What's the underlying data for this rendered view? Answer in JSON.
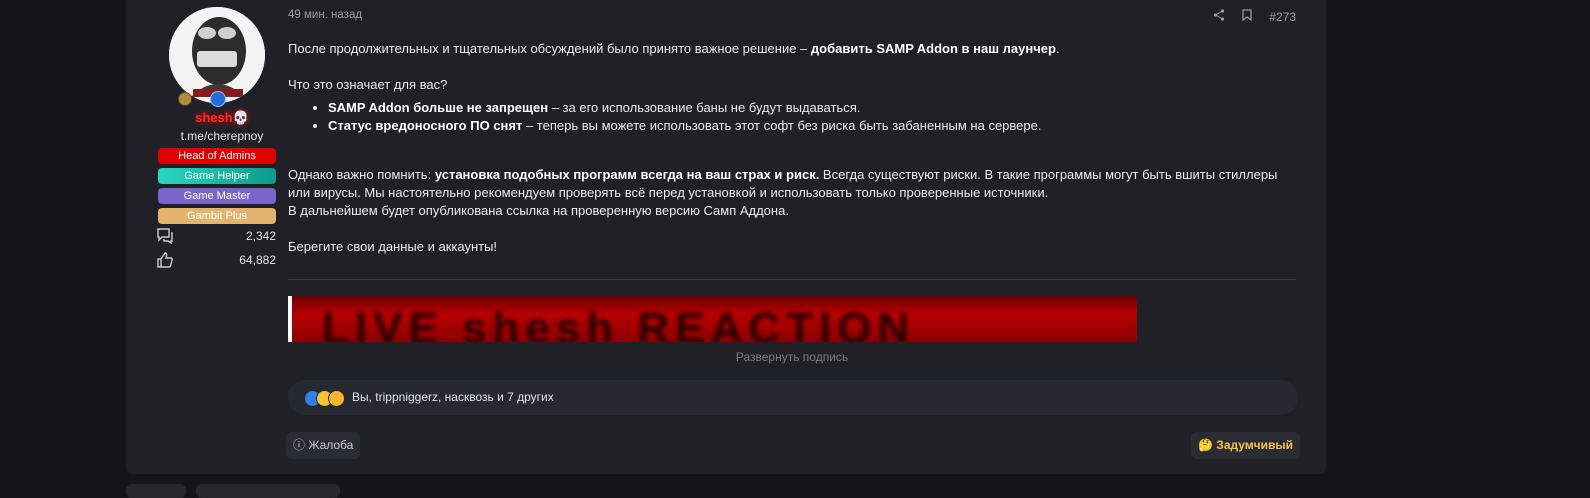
{
  "user": {
    "name": "shesh",
    "name_suffix_icon": "skull-icon",
    "link": "t.me/cherepnoy",
    "roles": [
      "Head of Admins",
      "Game Helper",
      "Game Master",
      "Gambit Plus"
    ],
    "messages_count": "2,342",
    "reactions_count": "64,882"
  },
  "post": {
    "time": "49 мин. назад",
    "number": "#273",
    "intro_plain": "После продолжительных и тщательных обсуждений было принято важное решение – ",
    "intro_bold": "добавить SAMP Addon в наш лаунчер",
    "intro_end": ".",
    "question": "Что это означает для вас?",
    "points": [
      {
        "bold": "SAMP Addon больше не запрещен",
        "text": " – за его использование баны не будут выдаваться."
      },
      {
        "bold": "Статус вредоносного ПО снят",
        "text": " – теперь вы можете использовать этот софт без риска быть забаненным на сервере."
      }
    ],
    "warn_plain": "Однако важно помнить: ",
    "warn_bold": "установка подобных программ всегда на ваш страх и риск.",
    "warn_rest": " Всегда существуют риски. В такие программы могут быть вшиты стиллеры или вирусы. Мы настоятельно рекомендуем проверять всё перед установкой и использовать только проверенные источники.",
    "link_note": "В дальнейшем будет опубликована ссылка на проверенную версию Самп Аддона.",
    "closing": "Берегите свои данные и аккаунты!"
  },
  "signature": {
    "expand_label": "Развернуть подпись"
  },
  "reactions": {
    "summary": "Вы, trippniggerz, насквозь и 7 других"
  },
  "footer": {
    "report_label": "Жалоба",
    "reaction_label": "Задумчивый"
  },
  "colors": {
    "background": "#141519",
    "panel": "#1f2127",
    "username": "#ff2a2a",
    "role_head_of_admins": "#e00000",
    "role_game_helper": "#1fb8a6",
    "role_game_master": "#7a66c9",
    "role_gambit_plus": "#e2b46d",
    "reaction_accent": "#f5c34a"
  }
}
